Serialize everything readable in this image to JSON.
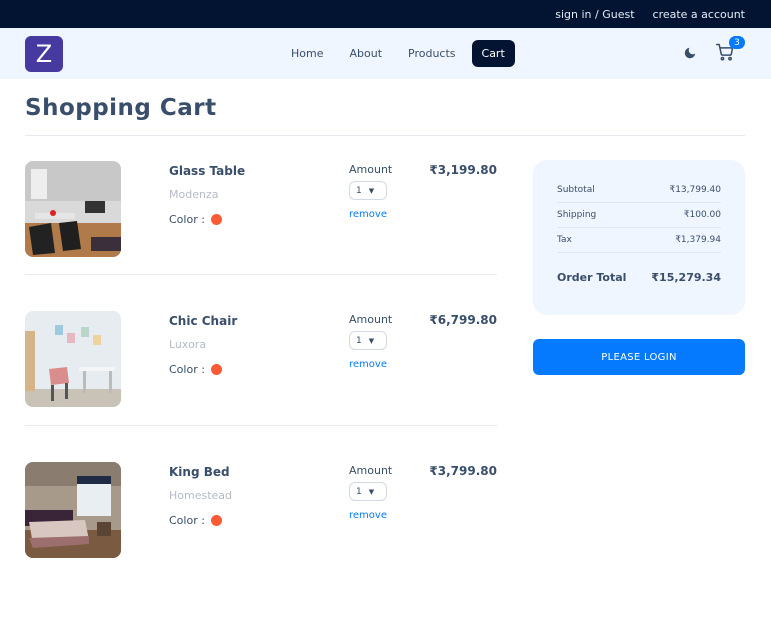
{
  "topbar": {
    "signin_label": "sign in / Guest",
    "create_account_label": "create a account"
  },
  "navbar": {
    "logo_letter": "Z",
    "links": [
      "Home",
      "About",
      "Products",
      "Cart"
    ],
    "active_link": "Cart",
    "cart_count": "3",
    "icons": {
      "theme_toggle": "moon-icon",
      "cart": "cart-icon"
    }
  },
  "page": {
    "title": "Shopping Cart"
  },
  "cart_items": [
    {
      "name": "Glass Table",
      "company": "Modenza",
      "color_label": "Color :",
      "color": "#ff5a36",
      "amount_label": "Amount",
      "amount": "1",
      "remove_label": "remove",
      "price": "₹3,199.80"
    },
    {
      "name": "Chic Chair",
      "company": "Luxora",
      "color_label": "Color :",
      "color": "#ff5a36",
      "amount_label": "Amount",
      "amount": "1",
      "remove_label": "remove",
      "price": "₹6,799.80"
    },
    {
      "name": "King Bed",
      "company": "Homestead",
      "color_label": "Color :",
      "color": "#ff5a36",
      "amount_label": "Amount",
      "amount": "1",
      "remove_label": "remove",
      "price": "₹3,799.80"
    }
  ],
  "totals": {
    "subtotal_label": "Subtotal",
    "subtotal": "₹13,799.40",
    "shipping_label": "Shipping",
    "shipping": "₹100.00",
    "tax_label": "Tax",
    "tax": "₹1,379.94",
    "order_total_label": "Order Total",
    "order_total": "₹15,279.34"
  },
  "login_button": "PLEASE LOGIN",
  "colors": {
    "topbar": "#021431",
    "nav_bg": "#f0f6ff",
    "logo": "#463aa1",
    "accent": "#057aff",
    "swatch": "#ff5a36"
  }
}
